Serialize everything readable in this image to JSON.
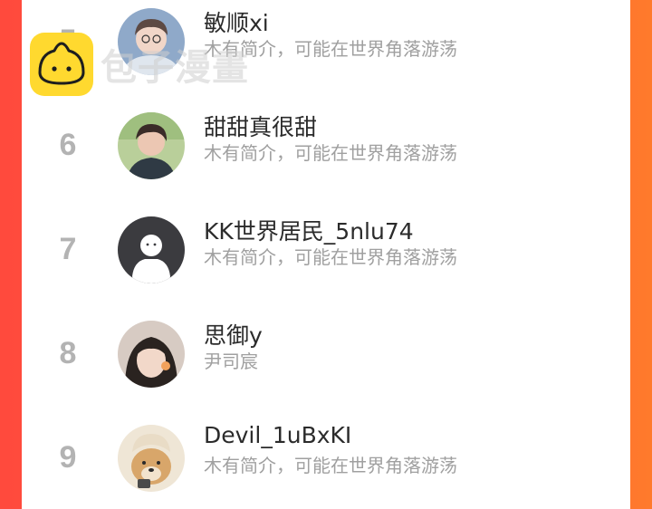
{
  "watermark": {
    "text": "包子漫畫",
    "icon": "bun-logo-icon"
  },
  "list": [
    {
      "rank": "5",
      "name": "敏顺xi",
      "bio": "木有简介，可能在世界角落游荡",
      "avatar": "boy-photo-avatar"
    },
    {
      "rank": "6",
      "name": "甜甜真很甜",
      "bio": "木有简介，可能在世界角落游荡",
      "avatar": "boy-photo-avatar"
    },
    {
      "rank": "7",
      "name": "KK世界居民_5nlu74",
      "bio": "木有简介，可能在世界角落游荡",
      "avatar": "default-ghost-avatar"
    },
    {
      "rank": "8",
      "name": "思御y",
      "bio": "尹司宸",
      "avatar": "girl-photo-avatar"
    },
    {
      "rank": "9",
      "name": "Devil_1uBxKI",
      "bio": "木有简介，可能在世界角落游荡",
      "avatar": "dog-photo-avatar"
    }
  ]
}
